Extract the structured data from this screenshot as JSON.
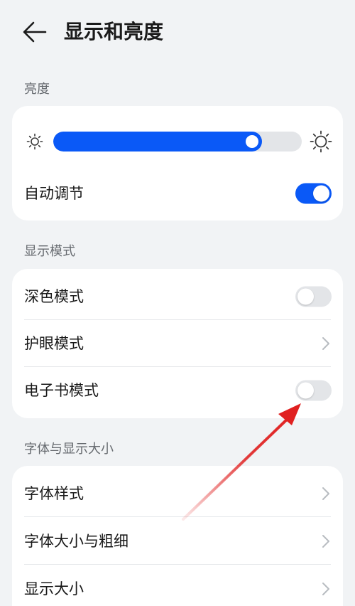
{
  "header": {
    "title": "显示和亮度",
    "back_icon": "arrow-left-icon"
  },
  "brightness": {
    "section_label": "亮度",
    "level": 0.84,
    "auto_label": "自动调节",
    "auto_on": true,
    "icons": [
      "sun-small-icon",
      "sun-large-icon"
    ]
  },
  "display_mode": {
    "section_label": "显示模式",
    "dark_mode_label": "深色模式",
    "dark_mode_on": false,
    "eye_comfort_label": "护眼模式",
    "ebook_mode_label": "电子书模式",
    "ebook_mode_on": false
  },
  "font_size": {
    "section_label": "字体与显示大小",
    "font_style_label": "字体样式",
    "font_size_weight_label": "字体大小与粗细",
    "display_size_label": "显示大小"
  },
  "colors": {
    "accent": "#0a59f7",
    "background": "#f1f3f5",
    "card": "#ffffff",
    "annotation_arrow": "#e02020"
  }
}
